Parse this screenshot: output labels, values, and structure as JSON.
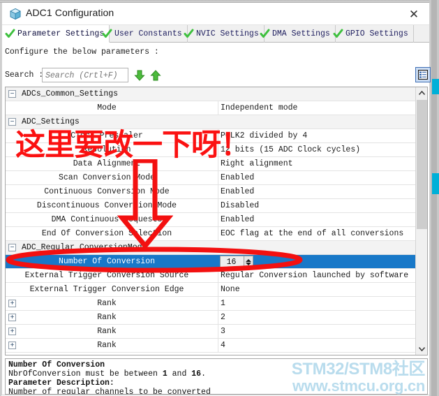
{
  "window": {
    "title": "ADC1 Configuration",
    "icon": "cube-icon",
    "close_label": "✕"
  },
  "tabs": [
    {
      "label": "Parameter Settings",
      "icon": "green-check-icon",
      "active": true
    },
    {
      "label": "User Constants",
      "icon": "green-check-icon",
      "active": false
    },
    {
      "label": "NVIC Settings",
      "icon": "green-check-icon",
      "active": false
    },
    {
      "label": "DMA Settings",
      "icon": "green-check-icon",
      "active": false
    },
    {
      "label": "GPIO Settings",
      "icon": "green-check-icon",
      "active": false
    }
  ],
  "toolbar": {
    "configure_text": "Configure the below parameters :",
    "search_label": "Search :",
    "search_value": "",
    "search_placeholder": "Search (Crtl+F)",
    "find_next_icon": "arrow-down-icon",
    "find_prev_icon": "arrow-up-icon",
    "list_view_icon": "list-view-icon"
  },
  "tree": {
    "rows": [
      {
        "kind": "group",
        "expander": "−",
        "name": "ADCs_Common_Settings"
      },
      {
        "kind": "param",
        "label": "Mode",
        "value": "Independent mode"
      },
      {
        "kind": "group",
        "expander": "−",
        "name": "ADC_Settings"
      },
      {
        "kind": "param",
        "label": "Clock Prescaler",
        "value": "PCLK2 divided by 4"
      },
      {
        "kind": "param",
        "label": "Resolution",
        "value": "12 bits (15 ADC Clock cycles)"
      },
      {
        "kind": "param",
        "label": "Data Alignment",
        "value": "Right alignment"
      },
      {
        "kind": "param",
        "label": "Scan Conversion Mode",
        "value": "Enabled"
      },
      {
        "kind": "param",
        "label": "Continuous Conversion Mode",
        "value": "Enabled"
      },
      {
        "kind": "param",
        "label": "Discontinuous Conversion Mode",
        "value": "Disabled"
      },
      {
        "kind": "param",
        "label": "DMA Continuous Requests",
        "value": "Enabled"
      },
      {
        "kind": "param",
        "label": "End Of Conversion Selection",
        "value": "EOC flag at the end of all conversions"
      },
      {
        "kind": "group",
        "expander": "−",
        "name": "ADC_Regular_ConversionMode"
      },
      {
        "kind": "spinner",
        "label": "Number Of Conversion",
        "value": "16",
        "selected": true
      },
      {
        "kind": "param",
        "label": "External Trigger Conversion Source",
        "value": "Regular Conversion launched by software"
      },
      {
        "kind": "param",
        "label": "External Trigger Conversion Edge",
        "value": "None"
      },
      {
        "kind": "param",
        "expander": "+",
        "label": "Rank",
        "value": "1"
      },
      {
        "kind": "param",
        "expander": "+",
        "label": "Rank",
        "value": "2"
      },
      {
        "kind": "param",
        "expander": "+",
        "label": "Rank",
        "value": "3"
      },
      {
        "kind": "param",
        "expander": "+",
        "label": "Rank",
        "value": "4"
      }
    ],
    "scrollbar": {
      "up_icon": "chevron-up-icon",
      "down_icon": "chevron-down-icon"
    }
  },
  "description": {
    "title": "Number Of Conversion",
    "constraint_prefix": "NbrOfConversion must be between ",
    "constraint_min": "1",
    "constraint_mid": " and ",
    "constraint_max": "16",
    "constraint_suffix": ".",
    "param_desc_label": "Parameter Description:",
    "param_desc_text": "Number of regular channels to be converted"
  },
  "watermark": {
    "line1": "STM32/STM8社区",
    "line2": "www.stmcu.org.cn",
    "color": "#b9dced"
  },
  "annotations": {
    "note_text": "这里要改一下呀！",
    "color": "#fb1111",
    "arrow_icon": "down-arrow-annotation",
    "oval_icon": "oval-highlight-annotation"
  }
}
